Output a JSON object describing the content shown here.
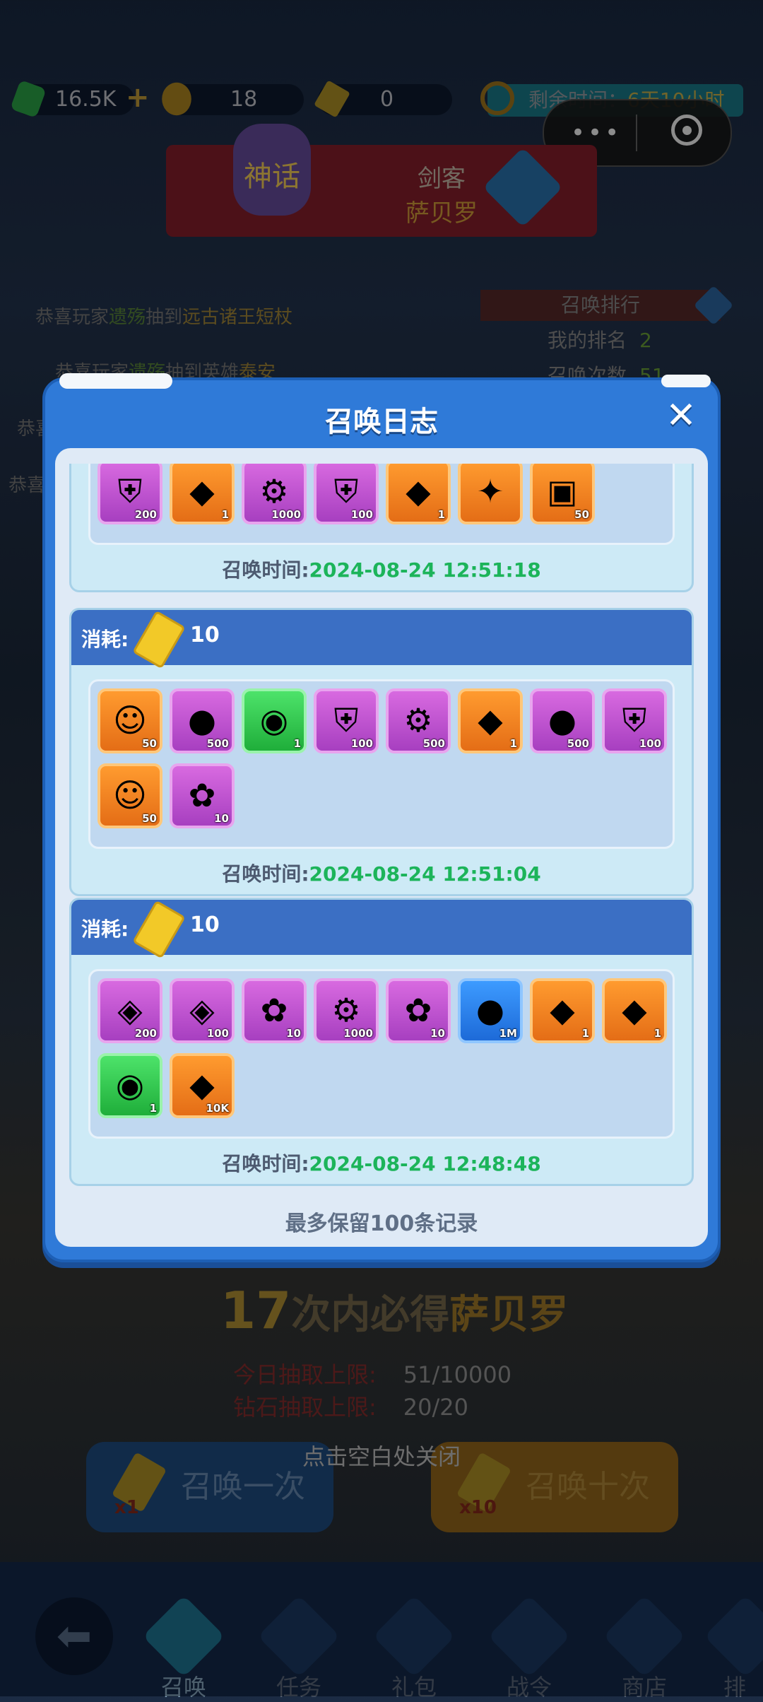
{
  "topbar": {
    "gems": "16.5K",
    "coins": "18",
    "tickets": "0",
    "timer_label": "剩余时间：",
    "timer_value": "6天10小时"
  },
  "banner": {
    "badge": "神话",
    "line1": "剑客",
    "line2": "萨贝罗"
  },
  "background": {
    "announce": [
      {
        "pre": "恭喜玩家",
        "name": "遗殇",
        "mid": "抽到",
        "item": "远古诸王短杖"
      },
      {
        "pre": "恭喜玩家",
        "name": "遗殇",
        "mid": "抽到英雄",
        "item": "泰安"
      }
    ],
    "side_fragments": [
      "恭喜",
      "恭喜"
    ],
    "rank_title": "召唤排行",
    "my_rank_label": "我的排名",
    "my_rank_value": "2",
    "count_label": "召唤次数",
    "count_value": "51",
    "pity_count": "17",
    "pity_text": "次内必得",
    "pity_hero": "萨贝罗",
    "daily_label": "今日抽取上限:",
    "daily_value": "51/10000",
    "diamond_label": "钻石抽取上限:",
    "diamond_value": "20/20",
    "close_hint": "点击空白处关闭",
    "btn_one": "召唤一次",
    "btn_one_mult": "x1",
    "btn_ten": "召唤十次",
    "btn_ten_mult": "x10"
  },
  "nav": [
    "召唤",
    "任务",
    "礼包",
    "战令",
    "商店",
    "排"
  ],
  "modal": {
    "title": "召唤日志",
    "cost_label": "消耗:",
    "time_label": "召唤时间:",
    "footer": "最多保留100条记录",
    "entries": [
      {
        "cost": "",
        "time": "2024-08-24 12:51:18",
        "items": [
          {
            "c": "purple",
            "g": "⛨",
            "n": "200"
          },
          {
            "c": "orange",
            "g": "◆",
            "n": "1"
          },
          {
            "c": "purple",
            "g": "⚙",
            "n": "1000"
          },
          {
            "c": "purple",
            "g": "⛨",
            "n": "100"
          },
          {
            "c": "orange",
            "g": "◆",
            "n": "1"
          },
          {
            "c": "orange",
            "g": "✦",
            "n": ""
          },
          {
            "c": "orange",
            "g": "▣",
            "n": "50"
          }
        ]
      },
      {
        "cost": "10",
        "time": "2024-08-24 12:51:04",
        "items": [
          {
            "c": "orange",
            "g": "☺",
            "n": "50"
          },
          {
            "c": "purple",
            "g": "●",
            "n": "500"
          },
          {
            "c": "green",
            "g": "◉",
            "n": "1"
          },
          {
            "c": "purple",
            "g": "⛨",
            "n": "100"
          },
          {
            "c": "purple",
            "g": "⚙",
            "n": "500"
          },
          {
            "c": "orange",
            "g": "◆",
            "n": "1"
          },
          {
            "c": "purple",
            "g": "●",
            "n": "500"
          },
          {
            "c": "purple",
            "g": "⛨",
            "n": "100"
          },
          {
            "c": "orange",
            "g": "☺",
            "n": "50"
          },
          {
            "c": "purple",
            "g": "✿",
            "n": "10"
          }
        ]
      },
      {
        "cost": "10",
        "time": "2024-08-24 12:48:48",
        "items": [
          {
            "c": "purple",
            "g": "◈",
            "n": "200"
          },
          {
            "c": "purple",
            "g": "◈",
            "n": "100"
          },
          {
            "c": "purple",
            "g": "✿",
            "n": "10"
          },
          {
            "c": "purple",
            "g": "⚙",
            "n": "1000"
          },
          {
            "c": "purple",
            "g": "✿",
            "n": "10"
          },
          {
            "c": "blue",
            "g": "●",
            "n": "1M"
          },
          {
            "c": "orange",
            "g": "◆",
            "n": "1"
          },
          {
            "c": "orange",
            "g": "◆",
            "n": "1"
          },
          {
            "c": "green",
            "g": "◉",
            "n": "1"
          },
          {
            "c": "orange",
            "g": "◆",
            "n": "10K"
          }
        ]
      }
    ]
  }
}
